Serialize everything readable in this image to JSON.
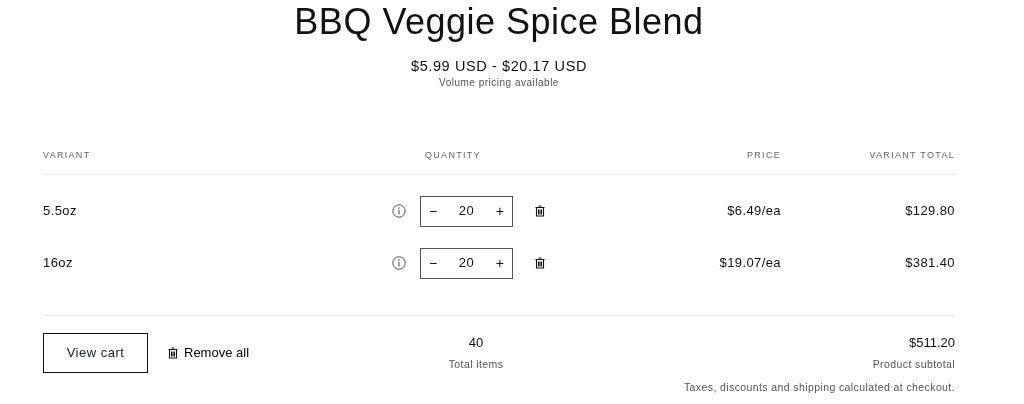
{
  "product": {
    "title": "BBQ Veggie Spice Blend",
    "price_range": "$5.99 USD - $20.17 USD",
    "note": "Volume pricing available"
  },
  "table": {
    "columns": [
      "VARIANT",
      "QUANTITY",
      "PRICE",
      "VARIANT TOTAL"
    ],
    "rows": [
      {
        "variant": "5.5oz",
        "decrease": "−",
        "quantity": "20",
        "increase": "+",
        "price": "$6.49/ea",
        "total": "$129.80"
      },
      {
        "variant": "16oz",
        "decrease": "−",
        "quantity": "20",
        "increase": "+",
        "price": "$19.07/ea",
        "total": "$381.40"
      }
    ]
  },
  "footer": {
    "view_cart": "View cart",
    "remove_all": "Remove all",
    "total_items": "40",
    "total_items_label": "Total items",
    "subtotal": "$511.20",
    "subtotal_label": "Product subtotal",
    "tax_note": "Taxes, discounts and shipping calculated at checkout."
  }
}
